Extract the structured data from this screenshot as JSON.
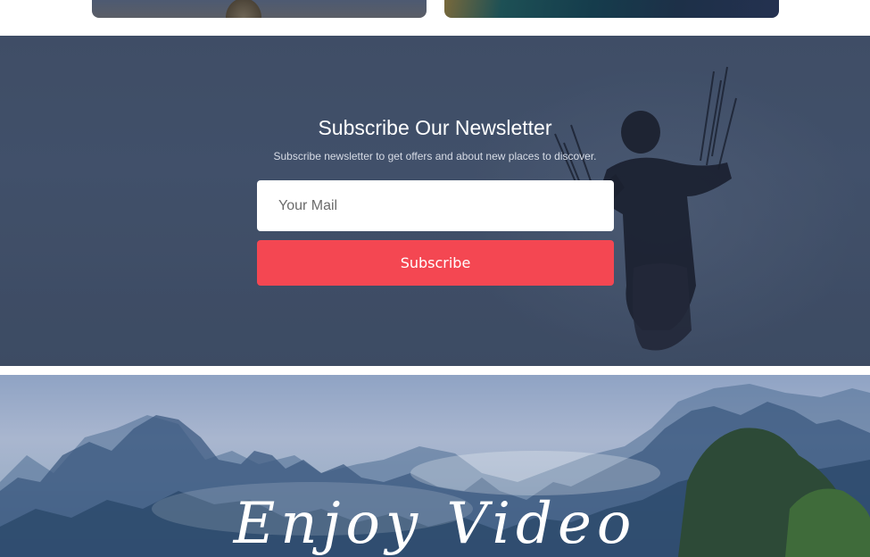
{
  "newsletter": {
    "title": "Subscribe Our Newsletter",
    "subtitle": "Subscribe newsletter to get offers and about new places to discover.",
    "email_placeholder": "Your Mail",
    "email_value": "",
    "subscribe_label": "Subscribe"
  },
  "video": {
    "title": "Enjoy Video"
  },
  "colors": {
    "accent": "#f44752",
    "newsletter_bg": "#47566f",
    "text_light": "#ffffff"
  }
}
